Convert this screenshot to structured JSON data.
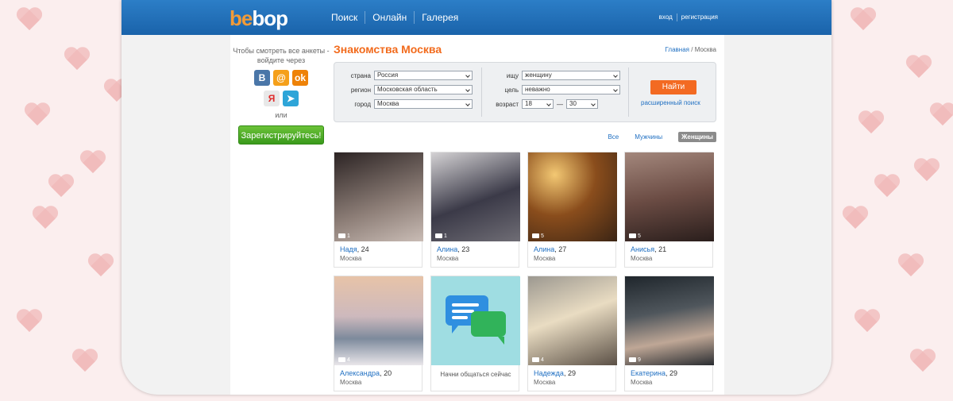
{
  "header": {
    "logo": "bebop",
    "nav": [
      "Поиск",
      "Онлайн",
      "Галерея"
    ],
    "auth": [
      "вход",
      "регистрация"
    ]
  },
  "sidebar": {
    "prompt": "Чтобы смотреть все анкеты - войдите через",
    "social": [
      {
        "label": "В",
        "color": "#4a76a8"
      },
      {
        "label": "@",
        "color": "#f5a01a"
      },
      {
        "label": "ok",
        "color": "#ee8208"
      },
      {
        "label": "Я",
        "color": "#e8e8e8"
      },
      {
        "label": "tg",
        "color": "#2ea5d8"
      }
    ],
    "or": "или",
    "register_button": "Зарегистрируйтесь!"
  },
  "main": {
    "title": "Знакомства Москва",
    "breadcrumb": {
      "home": "Главная",
      "sep": "/",
      "current": "Москва"
    }
  },
  "search": {
    "country_label": "страна",
    "country_value": "Россия",
    "region_label": "регион",
    "region_value": "Московская область",
    "city_label": "город",
    "city_value": "Москва",
    "seek_label": "ищу",
    "seek_value": "женщину",
    "goal_label": "цель",
    "goal_value": "неважно",
    "age_label": "возраст",
    "age_from": "18",
    "age_dash": "—",
    "age_to": "30",
    "find_button": "Найти",
    "advanced_link": "расширенный поиск"
  },
  "filters": [
    "Все",
    "Мужчины",
    "Женщины"
  ],
  "profiles": [
    {
      "name": "Надя",
      "age": "24",
      "city": "Москва",
      "photos": "1",
      "color": "#6b6464"
    },
    {
      "name": "Алина",
      "age": "23",
      "city": "Москва",
      "photos": "1",
      "color": "#4f4a4e"
    },
    {
      "name": "Алина",
      "age": "27",
      "city": "Москва",
      "photos": "5",
      "color": "#a06a2a"
    },
    {
      "name": "Анисья",
      "age": "21",
      "city": "Москва",
      "photos": "5",
      "color": "#7a5a52"
    },
    {
      "name": "Александра",
      "age": "20",
      "city": "Москва",
      "photos": "4",
      "color": "#c9b8b0"
    },
    {
      "name": "chat",
      "age": "",
      "city": "",
      "photos": "",
      "color": "#9fdde2"
    },
    {
      "name": "Надежда",
      "age": "29",
      "city": "Москва",
      "photos": "4",
      "color": "#7b6a60"
    },
    {
      "name": "Екатерина",
      "age": "29",
      "city": "Москва",
      "photos": "9",
      "color": "#3f4448"
    }
  ],
  "chat_prompt": "Начни общаться сейчас"
}
